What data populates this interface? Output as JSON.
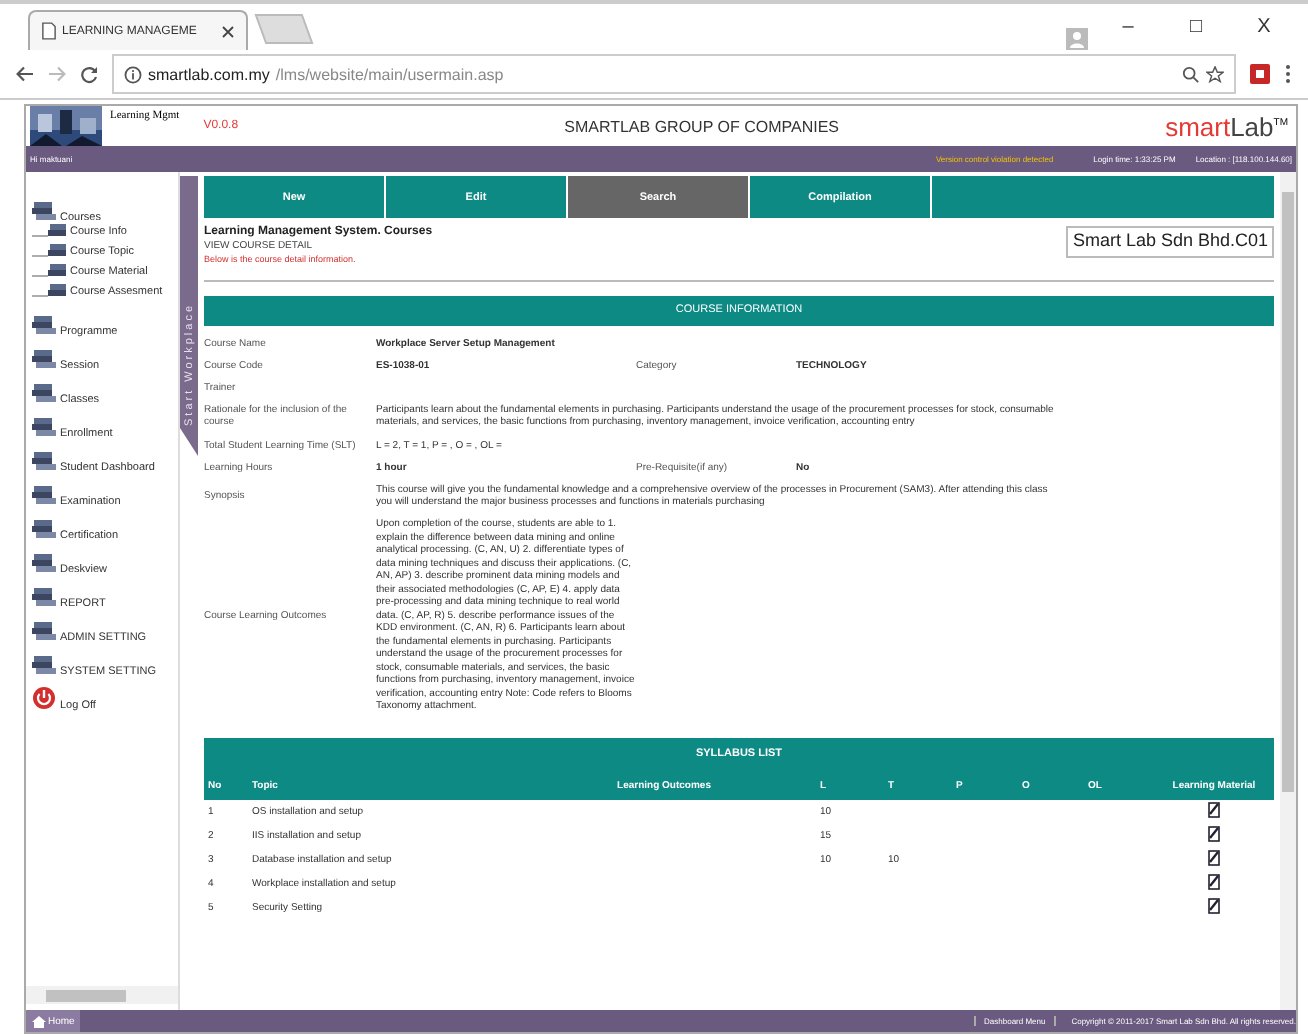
{
  "browser": {
    "tab_title": "LEARNING MANAGEME",
    "url_host": "smartlab.com.my",
    "url_path": "/lms/website/main/usermain.asp",
    "window_buttons": [
      "–",
      "□",
      "X"
    ]
  },
  "header": {
    "app_name": "Learning Mgmt",
    "version": "V0.0.8",
    "company": "SMARTLAB GROUP OF COMPANIES",
    "brand_main": "smart",
    "brand_sub": "Lab",
    "brand_mark": "TM"
  },
  "user_bar": {
    "greeting": "Hi maktuani",
    "warning": "Version control violation detected",
    "login_time": "Login time: 1:33:25 PM",
    "location": "Location : [118.100.144.60]"
  },
  "sidebar": {
    "items": [
      {
        "label": "Courses",
        "kind": "item",
        "children": [
          {
            "label": "Course Info"
          },
          {
            "label": "Course Topic"
          },
          {
            "label": "Course Material"
          },
          {
            "label": "Course Assesment"
          }
        ]
      },
      {
        "label": "Programme",
        "kind": "item"
      },
      {
        "label": "Session",
        "kind": "item"
      },
      {
        "label": "Classes",
        "kind": "item"
      },
      {
        "label": "Enrollment",
        "kind": "item"
      },
      {
        "label": "Student Dashboard",
        "kind": "item"
      },
      {
        "label": "Examination",
        "kind": "item"
      },
      {
        "label": "Certification",
        "kind": "item"
      },
      {
        "label": "Deskview",
        "kind": "item"
      },
      {
        "label": "REPORT",
        "kind": "item"
      },
      {
        "label": "ADMIN SETTING",
        "kind": "item"
      },
      {
        "label": "SYSTEM SETTING",
        "kind": "item"
      },
      {
        "label": "Log Off",
        "kind": "logoff"
      }
    ]
  },
  "side_tab": "Start Workplace",
  "nav_tabs": [
    {
      "label": "New",
      "selected": false
    },
    {
      "label": "Edit",
      "selected": false
    },
    {
      "label": "Search",
      "selected": true
    },
    {
      "label": "Compilation",
      "selected": false
    }
  ],
  "page": {
    "title": "Learning Management System. Courses",
    "subtitle": "VIEW COURSE DETAIL",
    "note": "Below is the course detail information.",
    "company": "Smart Lab Sdn Bhd.C01"
  },
  "course_info": {
    "title": "COURSE INFORMATION",
    "rows": [
      {
        "kind": "pair",
        "label": "Course Name",
        "value": "Workplace Server Setup Management"
      },
      {
        "kind": "double",
        "label": "Course Code",
        "value": "ES-1038-01",
        "label_2": "Category",
        "value_2": "TECHNOLOGY"
      },
      {
        "kind": "pair",
        "label": "Trainer"
      },
      {
        "kind": "wide",
        "label": "Rationale for the inclusion of the course",
        "value": "Participants learn about the fundamental elements in purchasing. Participants understand the usage of the procurement processes for stock, consumable materials, and services, the basic functions from purchasing, inventory management, invoice verification, accounting entry"
      },
      {
        "kind": "wide",
        "label": "Total Student Learning Time (SLT)",
        "value": "L = 2, T = 1, P = , O = , OL ="
      },
      {
        "kind": "double",
        "label": "Learning Hours",
        "value": "1 hour",
        "label_2": "Pre-Requisite(if any)",
        "value_2": "No"
      },
      {
        "kind": "wide",
        "label": "Synopsis",
        "value": "This course will give you the fundamental knowledge and a comprehensive overview of the processes in Procurement (SAM3). After attending this class you will understand the major business processes and functions in materials purchasing"
      },
      {
        "kind": "narrow",
        "label": "Course Learning Outcomes",
        "value": "Upon completion of the course, students are able to 1. explain the difference between data mining and online analytical processing. (C, AN, U) 2. differentiate types of data mining techniques and discuss their applications. (C, AN, AP) 3. describe prominent data mining models and their associated methodologies (C, AP, E) 4. apply data pre-processing and data mining technique to real world data. (C, AP, R) 5. describe performance issues of the KDD environment. (C, AN, R) 6. Participants learn about the fundamental elements in purchasing. Participants understand the usage of the procurement processes for stock, consumable materials, and services, the basic functions from purchasing, inventory management, invoice verification, accounting entry Note: Code refers to Blooms Taxonomy attachment."
      }
    ]
  },
  "syllabus": {
    "title": "SYLLABUS LIST",
    "columns": [
      "No",
      "Topic",
      "Learning Outcomes",
      "L",
      "T",
      "P",
      "O",
      "OL",
      "Learning Material"
    ],
    "rows": [
      {
        "no": "1",
        "topic": "OS installation and setup",
        "l": "10",
        "t": ""
      },
      {
        "no": "2",
        "topic": "IIS installation and setup",
        "l": "15",
        "t": ""
      },
      {
        "no": "3",
        "topic": "Database installation and setup",
        "l": "10",
        "t": "10"
      },
      {
        "no": "4",
        "topic": "Workplace installation and setup",
        "l": "",
        "t": ""
      },
      {
        "no": "5",
        "topic": "Security Setting",
        "l": "",
        "t": ""
      }
    ]
  },
  "footer": {
    "home": "Home",
    "dashboard": "Dashboard Menu",
    "copyright": "Copyright © 2011-2017 Smart Lab Sdn Bhd. All rights reserved."
  }
}
